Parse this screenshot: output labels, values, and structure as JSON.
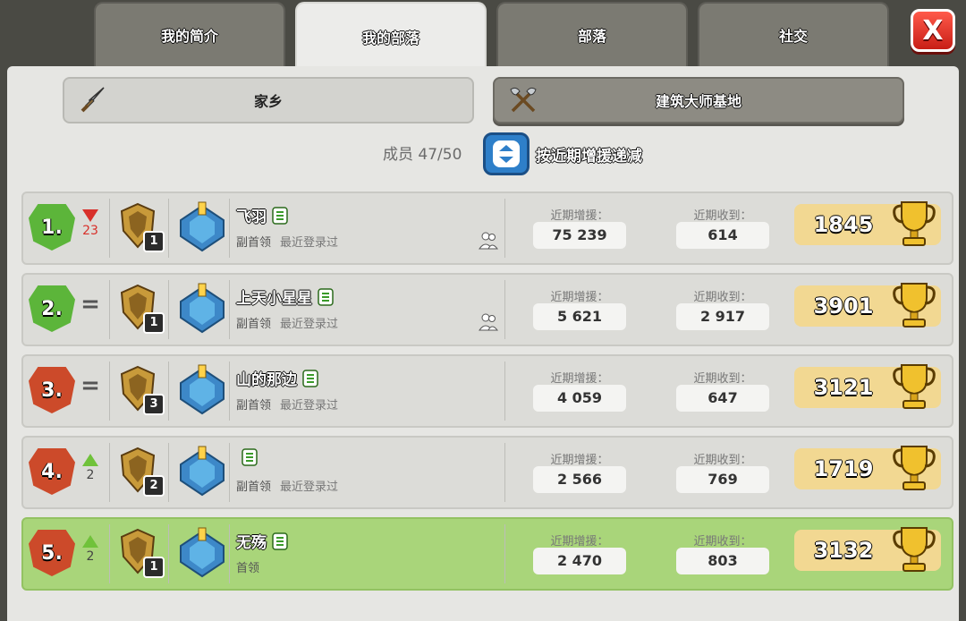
{
  "tabs": [
    "我的简介",
    "我的部落",
    "部落",
    "社交"
  ],
  "close_label": "X",
  "subtabs": {
    "home": "家乡",
    "builder": "建筑大师基地"
  },
  "members_label": "成员 47/50",
  "sort_label": "按近期增援递减",
  "stat_labels": {
    "donated": "近期增援：",
    "received": "近期收到："
  },
  "colors": {
    "accent_blue": "#2e7fc9",
    "rank_green": "#5cb53a",
    "rank_red": "#cc4a2a",
    "self_row": "#a9d57a"
  },
  "rows": [
    {
      "rank": "1.",
      "rank_color": "green",
      "trend": "down",
      "trend_value": "23",
      "badge_level": "1",
      "name": "飞羽",
      "role": "副首领",
      "last_login": "最近登录过",
      "friend": true,
      "donated": "75 239",
      "received": "614",
      "trophies": "1845",
      "self": false
    },
    {
      "rank": "2.",
      "rank_color": "green",
      "trend": "same",
      "trend_value": "",
      "badge_level": "1",
      "name": "上天小星星",
      "role": "副首领",
      "last_login": "最近登录过",
      "friend": true,
      "donated": "5 621",
      "received": "2 917",
      "trophies": "3901",
      "self": false
    },
    {
      "rank": "3.",
      "rank_color": "red",
      "trend": "same",
      "trend_value": "",
      "badge_level": "3",
      "name": "山的那边",
      "role": "副首领",
      "last_login": "最近登录过",
      "friend": false,
      "donated": "4 059",
      "received": "647",
      "trophies": "3121",
      "self": false
    },
    {
      "rank": "4.",
      "rank_color": "red",
      "trend": "up",
      "trend_value": "2",
      "badge_level": "2",
      "name": "",
      "role": "副首领",
      "last_login": "最近登录过",
      "friend": false,
      "donated": "2 566",
      "received": "769",
      "trophies": "1719",
      "self": false
    },
    {
      "rank": "5.",
      "rank_color": "red",
      "trend": "up",
      "trend_value": "2",
      "badge_level": "1",
      "name": "无殇",
      "role": "首领",
      "last_login": "",
      "friend": false,
      "donated": "2 470",
      "received": "803",
      "trophies": "3132",
      "self": true
    }
  ]
}
